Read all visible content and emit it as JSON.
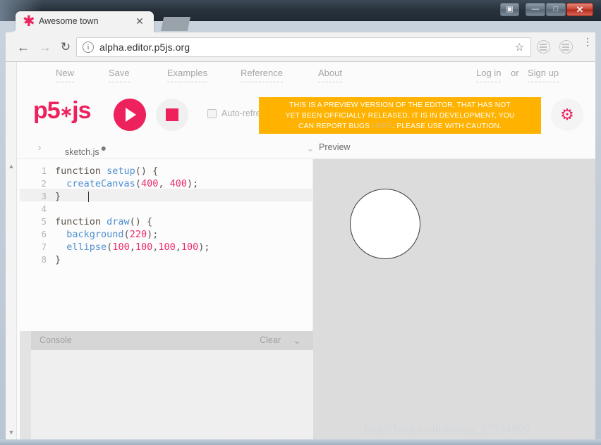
{
  "window": {
    "buttons": {
      "user": "▣",
      "minimize": "—",
      "maximize": "□",
      "close": "✕"
    }
  },
  "browser": {
    "tab": {
      "title": "Awesome town",
      "favicon": "✱",
      "close": "✕"
    },
    "toolbar": {
      "back": "←",
      "forward": "→",
      "reload": "↻",
      "info": "i",
      "url": "alpha.editor.p5js.org",
      "star": "☆",
      "menu": "⋮"
    }
  },
  "p5nav": {
    "left_links": [
      "New",
      "Save",
      "Examples",
      "Reference",
      "About"
    ],
    "right_links": [
      "Log in",
      "or",
      "Sign up"
    ]
  },
  "toolbar": {
    "logo_p5": "p5",
    "logo_star": "∗",
    "logo_js": "js",
    "play_label": "play",
    "stop_label": "stop",
    "auto_refresh_label": "Auto-refresh",
    "auto_refresh_checked": false,
    "settings_icon": "⚙",
    "banner": {
      "line1": "THIS IS A PREVIEW VERSION OF THE EDITOR, THAT HAS NOT",
      "line2a": "YET BEEN OFFICIALLY RELEASED. IT IS IN DEVELOPMENT, YOU",
      "line3a": "CAN REPORT BUGS ",
      "link": "HERE",
      "line3b": ". PLEASE USE WITH CAUTION.",
      "color": "#ffb300"
    }
  },
  "tabstrip": {
    "sidebar_chevron": "›",
    "filename": "sketch.js",
    "unsaved_dot": "●",
    "preview_chevron": "⌄",
    "preview_label": "Preview"
  },
  "editor": {
    "line_numbers": [
      "1",
      "2",
      "3",
      "4",
      "5",
      "6",
      "7",
      "8"
    ],
    "active_line": 3,
    "lines": [
      {
        "n": "1",
        "tokens": [
          {
            "t": "function ",
            "c": "kw"
          },
          {
            "t": "setup",
            "c": "fn"
          },
          {
            "t": "() {",
            "c": "punc"
          }
        ]
      },
      {
        "n": "2",
        "tokens": [
          {
            "t": "  ",
            "c": "punc"
          },
          {
            "t": "createCanvas",
            "c": "fn"
          },
          {
            "t": "(",
            "c": "punc"
          },
          {
            "t": "400",
            "c": "num"
          },
          {
            "t": ", ",
            "c": "punc"
          },
          {
            "t": "400",
            "c": "num"
          },
          {
            "t": ");",
            "c": "punc"
          }
        ]
      },
      {
        "n": "3",
        "tokens": [
          {
            "t": "}",
            "c": "punc"
          }
        ]
      },
      {
        "n": "4",
        "tokens": []
      },
      {
        "n": "5",
        "tokens": [
          {
            "t": "function ",
            "c": "kw"
          },
          {
            "t": "draw",
            "c": "fn"
          },
          {
            "t": "() {",
            "c": "punc"
          }
        ]
      },
      {
        "n": "6",
        "tokens": [
          {
            "t": "  ",
            "c": "punc"
          },
          {
            "t": "background",
            "c": "fn"
          },
          {
            "t": "(",
            "c": "punc"
          },
          {
            "t": "220",
            "c": "num"
          },
          {
            "t": ");",
            "c": "punc"
          }
        ]
      },
      {
        "n": "7",
        "tokens": [
          {
            "t": "  ",
            "c": "punc"
          },
          {
            "t": "ellipse",
            "c": "fn"
          },
          {
            "t": "(",
            "c": "punc"
          },
          {
            "t": "100",
            "c": "num"
          },
          {
            "t": ",",
            "c": "punc"
          },
          {
            "t": "100",
            "c": "num"
          },
          {
            "t": ",",
            "c": "punc"
          },
          {
            "t": "100",
            "c": "num"
          },
          {
            "t": ",",
            "c": "punc"
          },
          {
            "t": "100",
            "c": "num"
          },
          {
            "t": ");",
            "c": "punc"
          }
        ]
      },
      {
        "n": "8",
        "tokens": [
          {
            "t": "}",
            "c": "punc"
          }
        ]
      }
    ]
  },
  "console": {
    "label": "Console",
    "clear_label": "Clear",
    "chevron": "⌄"
  },
  "preview": {
    "background": "#dcdcdc",
    "shape": "ellipse",
    "fill": "#ffffff",
    "stroke": "#3b3b3b"
  },
  "watermark": "http://blog.csdn.net/qq_27534999",
  "colors": {
    "brand_pink": "#ed225d",
    "banner_yellow": "#ffb300"
  }
}
